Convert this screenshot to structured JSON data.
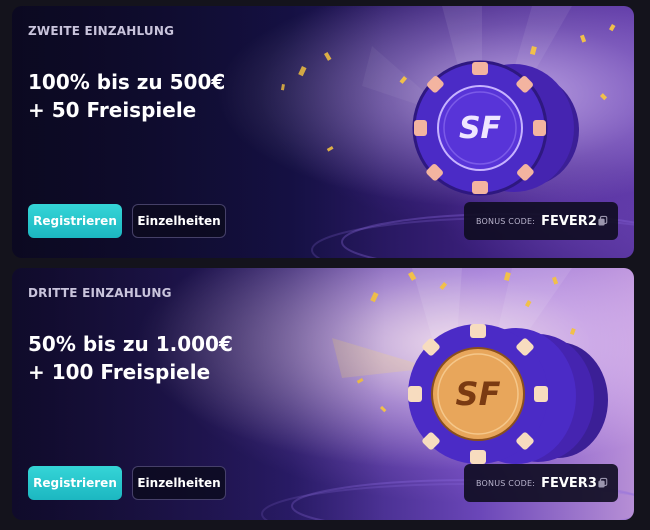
{
  "offers": [
    {
      "kicker": "ZWEITE EINZAHLUNG",
      "headline_line1": "100% bis zu 500€",
      "headline_line2": "+ 50 Freispiele",
      "register_label": "Registrieren",
      "details_label": "Einzelheiten",
      "bonus_code_label": "BONUS CODE:",
      "bonus_code": "FEVER2",
      "chip_text": "SF"
    },
    {
      "kicker": "DRITTE EINZAHLUNG",
      "headline_line1": "50% bis zu 1.000€",
      "headline_line2": "+ 100 Freispiele",
      "register_label": "Registrieren",
      "details_label": "Einzelheiten",
      "bonus_code_label": "BONUS CODE:",
      "bonus_code": "FEVER3",
      "chip_text": "SF"
    }
  ],
  "colors": {
    "accent": "#1cb7c1",
    "chip_purple": "#4a2bc4",
    "chip_gold": "#f0b25a"
  },
  "icons": {
    "copy": "copy-icon",
    "chip": "poker-chip-logo"
  }
}
